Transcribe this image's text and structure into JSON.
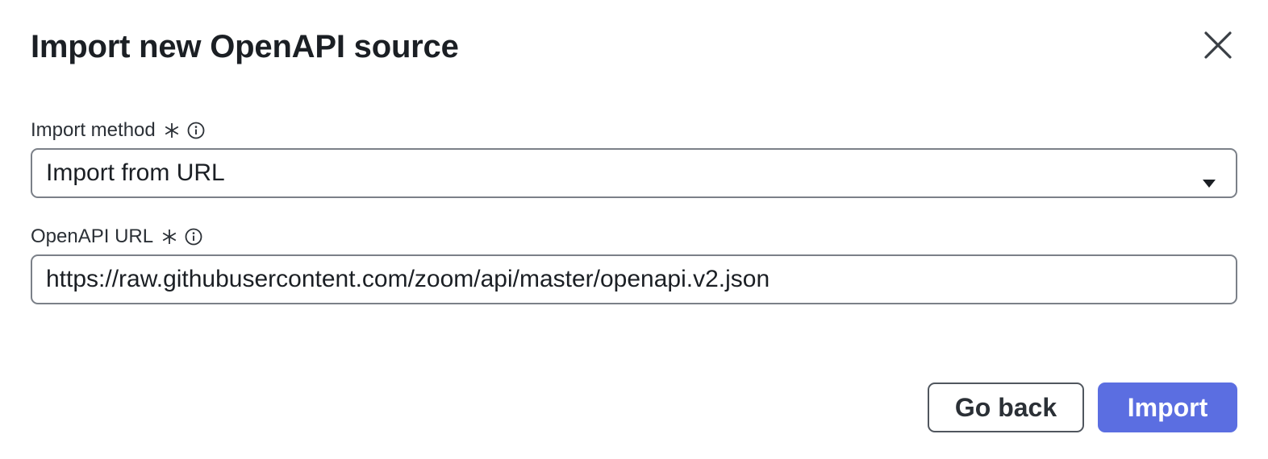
{
  "dialog": {
    "title": "Import new OpenAPI source",
    "close_icon": "close-icon"
  },
  "import_method": {
    "label": "Import method",
    "required_icon": "asterisk-icon",
    "info_icon": "info-icon",
    "selected_value": "Import from URL",
    "dropdown_icon": "caret-down-icon"
  },
  "openapi_url": {
    "label": "OpenAPI URL",
    "required_icon": "asterisk-icon",
    "info_icon": "info-icon",
    "value": "https://raw.githubusercontent.com/zoom/api/master/openapi.v2.json"
  },
  "actions": {
    "go_back_label": "Go back",
    "import_label": "Import"
  },
  "colors": {
    "primary": "#5b6ee1",
    "border": "#7b8088",
    "text": "#1b1f24"
  }
}
